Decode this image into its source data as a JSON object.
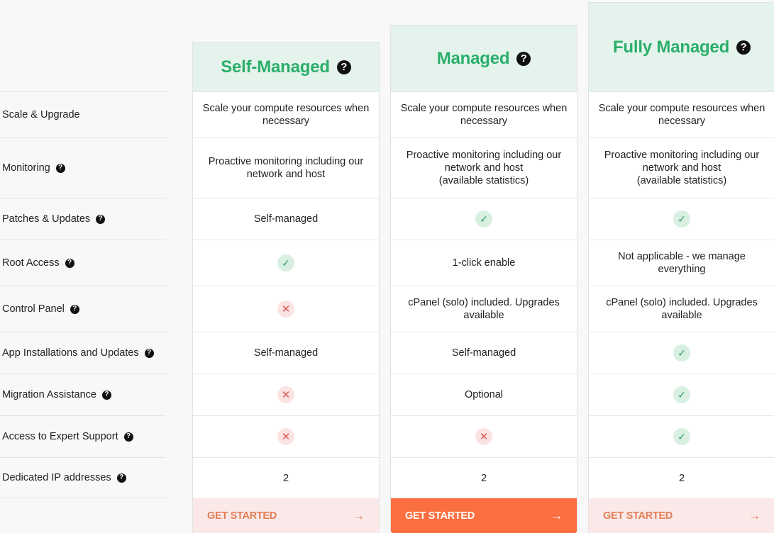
{
  "features": [
    {
      "label": "Scale & Upgrade",
      "help": false
    },
    {
      "label": "Monitoring",
      "help": true
    },
    {
      "label": "Patches & Updates",
      "help": true
    },
    {
      "label": "Root Access",
      "help": true
    },
    {
      "label": "Control Panel",
      "help": true
    },
    {
      "label": "App Installations and Updates",
      "help": true
    },
    {
      "label": "Migration Assistance",
      "help": true
    },
    {
      "label": "Access to Expert Support",
      "help": true
    },
    {
      "label": "Dedicated IP addresses",
      "help": true
    }
  ],
  "help_glyph": "?",
  "icons": {
    "check": "✓",
    "cross": "✕",
    "arrow": "→"
  },
  "plans": [
    {
      "name": "Self-Managed",
      "cta": "GET STARTED",
      "cta_style": "light",
      "values": [
        {
          "type": "text",
          "text": "Scale your compute resources when\nnecessary"
        },
        {
          "type": "text",
          "text": "Proactive monitoring including our\nnetwork and host"
        },
        {
          "type": "text",
          "text": "Self-managed"
        },
        {
          "type": "check"
        },
        {
          "type": "cross"
        },
        {
          "type": "text",
          "text": "Self-managed"
        },
        {
          "type": "cross"
        },
        {
          "type": "cross"
        },
        {
          "type": "text",
          "text": "2"
        }
      ]
    },
    {
      "name": "Managed",
      "cta": "GET STARTED",
      "cta_style": "solid",
      "values": [
        {
          "type": "text",
          "text": "Scale your compute resources when\nnecessary"
        },
        {
          "type": "text",
          "text": "Proactive monitoring including our\nnetwork and host\n(available statistics)"
        },
        {
          "type": "check"
        },
        {
          "type": "text",
          "text": "1-click enable"
        },
        {
          "type": "text",
          "text": "cPanel (solo) included. Upgrades\navailable"
        },
        {
          "type": "text",
          "text": "Self-managed"
        },
        {
          "type": "text",
          "text": "Optional"
        },
        {
          "type": "cross"
        },
        {
          "type": "text",
          "text": "2"
        }
      ]
    },
    {
      "name": "Fully Managed",
      "cta": "GET STARTED",
      "cta_style": "light",
      "values": [
        {
          "type": "text",
          "text": "Scale your compute resources when\nnecessary"
        },
        {
          "type": "text",
          "text": "Proactive monitoring including our\nnetwork and host\n(available statistics)"
        },
        {
          "type": "check"
        },
        {
          "type": "text",
          "text": "Not applicable - we manage\neverything"
        },
        {
          "type": "text",
          "text": "cPanel (solo) included. Upgrades\navailable"
        },
        {
          "type": "check"
        },
        {
          "type": "check"
        },
        {
          "type": "check"
        },
        {
          "type": "text",
          "text": "2"
        }
      ]
    }
  ],
  "colors": {
    "title_green": "#2bae6a",
    "header_bg": "#e4f3ec",
    "cta_orange": "#fb6e3f",
    "cta_light_bg": "#fae9e8",
    "cta_light_text": "#e37d56"
  }
}
